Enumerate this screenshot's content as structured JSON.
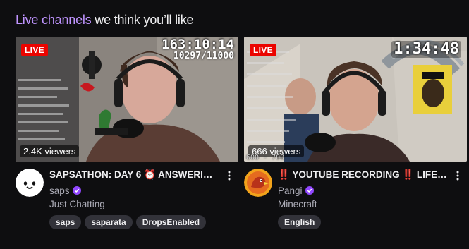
{
  "shelf": {
    "title_accent": "Live channels",
    "title_rest": " we think you’ll like"
  },
  "cards": [
    {
      "live_label": "LIVE",
      "viewers": "2.4K viewers",
      "overlay_timer": "163:10:14",
      "overlay_sub": "10297/11000",
      "title": "SAPSATHON: DAY 6 ⏰ ANSWERING…",
      "channel": "saps",
      "category": "Just Chatting",
      "tags": [
        "saps",
        "saparata",
        "DropsEnabled"
      ],
      "avatar_icon": "ghost-face-icon"
    },
    {
      "live_label": "LIVE",
      "viewers": "666 viewers",
      "overlay_timer": "1:34:48",
      "overlay_small": "600 - 700",
      "title": "‼️ YOUTUBE RECORDING ‼️ LIFES…",
      "channel": "Pangi",
      "category": "Minecraft",
      "tags": [
        "English"
      ],
      "avatar_icon": "bird-avatar-icon"
    }
  ],
  "colors": {
    "accent": "#bf94ff",
    "live": "#eb0400",
    "verified": "#9147ff",
    "tag_bg": "#323239"
  }
}
